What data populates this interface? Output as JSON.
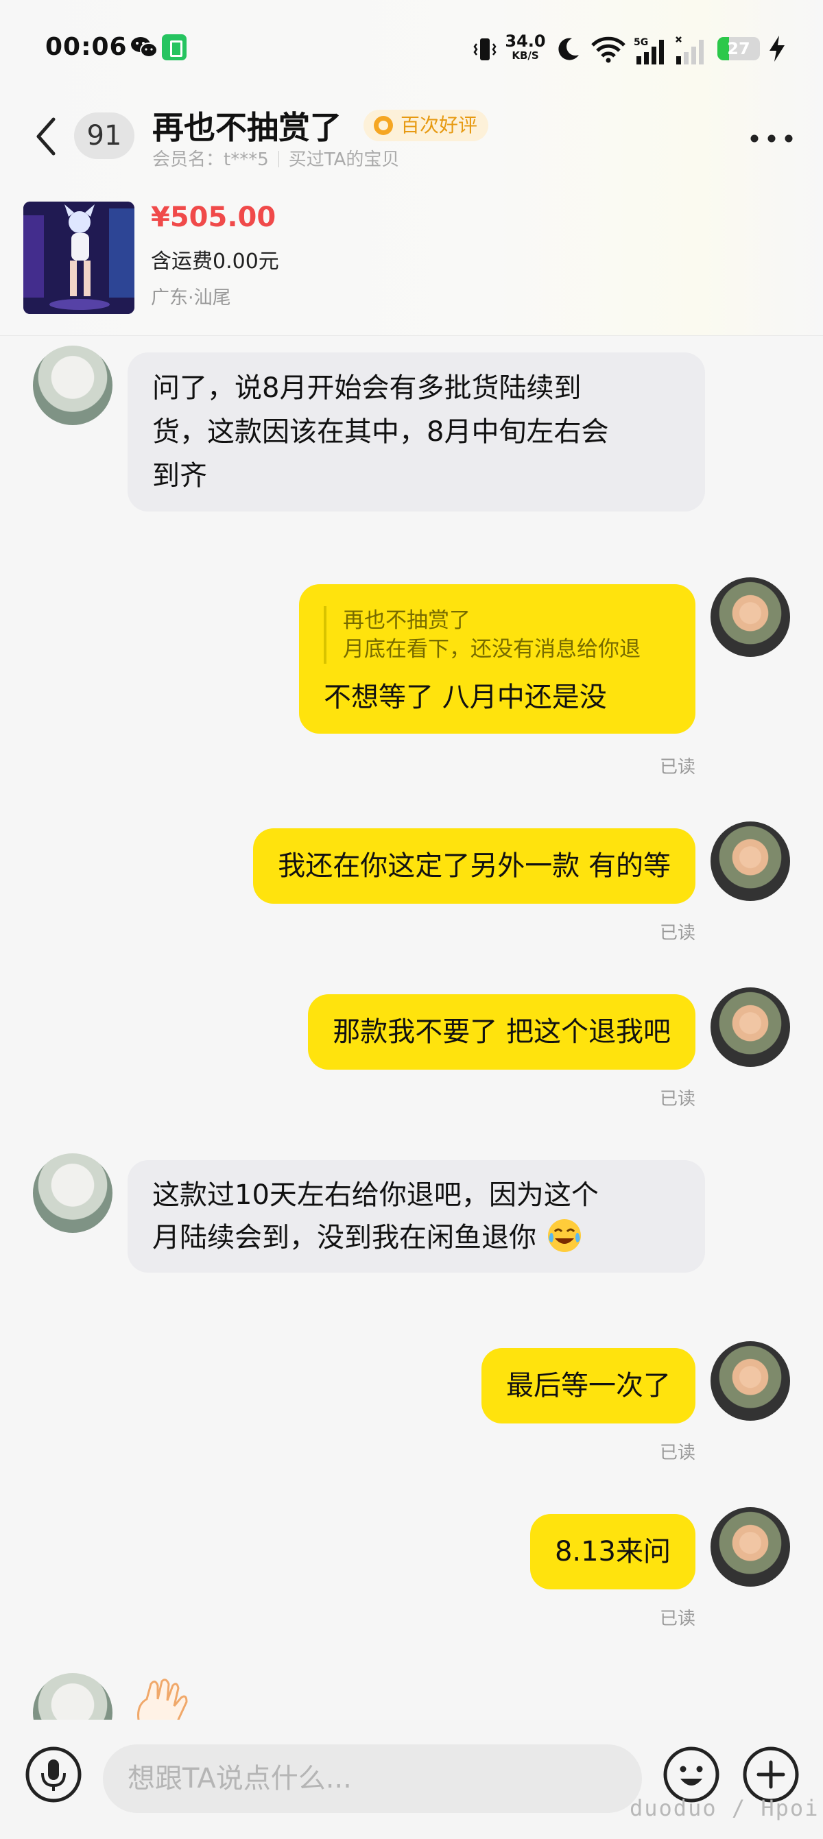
{
  "status_bar": {
    "time": "00:06",
    "net_speed": "34.0",
    "net_unit": "KB/S",
    "signal_label": "5G",
    "battery_percent": 27,
    "battery_color": "#2cc84a"
  },
  "header": {
    "unread_count": "91",
    "title": "再也不抽赏了",
    "badge": "百次好评",
    "member_label": "会员名：t***5",
    "bought_label": "买过TA的宝贝"
  },
  "item": {
    "price": "¥505.00",
    "shipping": "含运费0.00元",
    "location": "广东·汕尾"
  },
  "messages": [
    {
      "from": "seller",
      "text": "问了，说8月开始会有多批货陆续到\n货，这款因该在其中，8月中旬左右会\n到齐"
    },
    {
      "from": "me",
      "quote_name": "再也不抽赏了",
      "quote_text": "月底在看下，还没有消息给你退",
      "text": "不想等了 八月中还是没",
      "status": "已读"
    },
    {
      "from": "me",
      "text": "我还在你这定了另外一款 有的等",
      "status": "已读"
    },
    {
      "from": "me",
      "text": "那款我不要了 把这个退我吧",
      "status": "已读"
    },
    {
      "from": "seller",
      "text": "这款过10天左右给你退吧，因为这个\n月陆续会到，没到我在闲鱼退你",
      "emoji": "tears-of-joy-emoji"
    },
    {
      "from": "me",
      "text": "最后等一次了",
      "status": "已读"
    },
    {
      "from": "me",
      "text": "8.13来问",
      "status": "已读"
    }
  ],
  "input": {
    "placeholder": "想跟TA说点什么..."
  },
  "watermark": "duoduo / Hpoi",
  "colors": {
    "outgoing_bubble": "#ffe30d",
    "incoming_bubble": "#ececef",
    "price": "#f04a4a",
    "badge_text": "#e79a12"
  }
}
